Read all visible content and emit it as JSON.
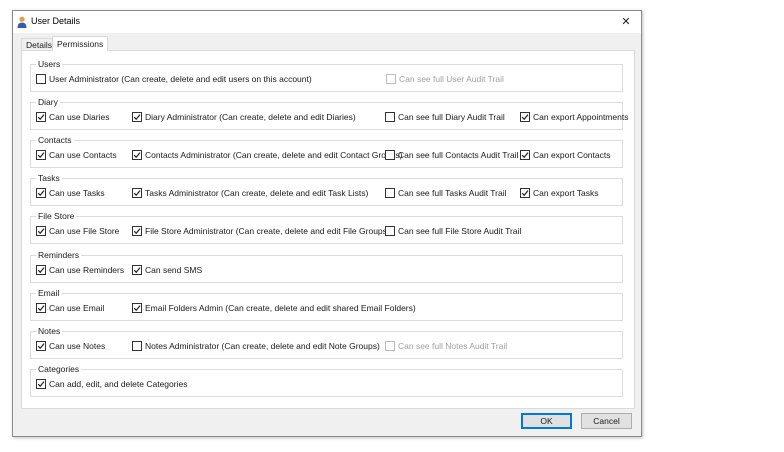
{
  "window": {
    "title": "User Details",
    "close_glyph": "✕"
  },
  "tabs": [
    {
      "label": "Details",
      "active": false
    },
    {
      "label": "Permissions",
      "active": true
    }
  ],
  "groups": [
    {
      "title": "Users",
      "items": [
        {
          "label": "User Administrator (Can create, delete and edit users on this account)",
          "checked": false,
          "enabled": true
        },
        {
          "label": "Can see full User Audit Trail",
          "checked": false,
          "enabled": false
        }
      ]
    },
    {
      "title": "Diary",
      "items": [
        {
          "label": "Can use Diaries",
          "checked": true,
          "enabled": true
        },
        {
          "label": "Diary Administrator (Can create, delete and edit Diaries)",
          "checked": true,
          "enabled": true
        },
        {
          "label": "Can see full Diary Audit Trail",
          "checked": false,
          "enabled": true
        },
        {
          "label": "Can export Appointments",
          "checked": true,
          "enabled": true
        }
      ]
    },
    {
      "title": "Contacts",
      "items": [
        {
          "label": "Can use Contacts",
          "checked": true,
          "enabled": true
        },
        {
          "label": "Contacts Administrator (Can create, delete and edit Contact Groups)",
          "checked": true,
          "enabled": true
        },
        {
          "label": "Can see full Contacts Audit Trail",
          "checked": false,
          "enabled": true
        },
        {
          "label": "Can export Contacts",
          "checked": true,
          "enabled": true
        }
      ]
    },
    {
      "title": "Tasks",
      "items": [
        {
          "label": "Can use Tasks",
          "checked": true,
          "enabled": true
        },
        {
          "label": "Tasks Administrator (Can create, delete and edit Task Lists)",
          "checked": true,
          "enabled": true
        },
        {
          "label": "Can see full Tasks Audit Trail",
          "checked": false,
          "enabled": true
        },
        {
          "label": "Can export Tasks",
          "checked": true,
          "enabled": true
        }
      ]
    },
    {
      "title": "File Store",
      "items": [
        {
          "label": "Can use File Store",
          "checked": true,
          "enabled": true
        },
        {
          "label": "File Store Administrator (Can create, delete and edit File Groups)",
          "checked": true,
          "enabled": true
        },
        {
          "label": "Can see full File Store Audit Trail",
          "checked": false,
          "enabled": true
        }
      ]
    },
    {
      "title": "Reminders",
      "items": [
        {
          "label": "Can use Reminders",
          "checked": true,
          "enabled": true
        },
        {
          "label": "Can send SMS",
          "checked": true,
          "enabled": true
        }
      ]
    },
    {
      "title": "Email",
      "items": [
        {
          "label": "Can use Email",
          "checked": true,
          "enabled": true
        },
        {
          "label": "Email Folders Admin (Can create, delete and edit shared Email Folders)",
          "checked": true,
          "enabled": true
        }
      ]
    },
    {
      "title": "Notes",
      "items": [
        {
          "label": "Can use Notes",
          "checked": true,
          "enabled": true
        },
        {
          "label": "Notes Administrator (Can create, delete and edit Note Groups)",
          "checked": false,
          "enabled": true
        },
        {
          "label": "Can see full Notes Audit Trail",
          "checked": false,
          "enabled": false
        }
      ]
    },
    {
      "title": "Categories",
      "items": [
        {
          "label": "Can add, edit, and delete Categories",
          "checked": true,
          "enabled": true
        }
      ]
    }
  ],
  "buttons": {
    "ok": "OK",
    "cancel": "Cancel"
  }
}
